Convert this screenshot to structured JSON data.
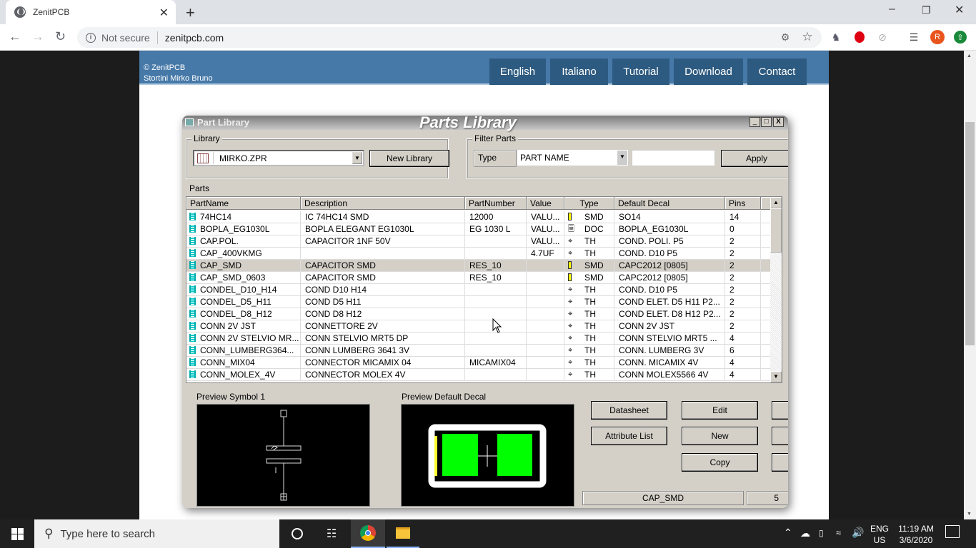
{
  "browser": {
    "tab_title": "ZenitPCB",
    "security_label": "Not secure",
    "url": "zenitpcb.com",
    "profile_initial": "R"
  },
  "site": {
    "copyright": "© ZenitPCB",
    "author": "Stortini Mirko Bruno",
    "menu": [
      "English",
      "Italiano",
      "Tutorial",
      "Download",
      "Contact"
    ]
  },
  "dialog": {
    "window_title": "Part Library",
    "banner_title": "Parts Library",
    "library_group": "Library",
    "library_value": "MIRKO.ZPR",
    "new_library": "New Library",
    "filter_group": "Filter Parts",
    "filter_type_label": "Type",
    "filter_type_value": "PART NAME",
    "filter_text": "",
    "apply": "Apply",
    "parts_label": "Parts",
    "columns": [
      "PartName",
      "Description",
      "PartNumber",
      "Value",
      "Type",
      "Default Decal",
      "Pins"
    ],
    "rows": [
      {
        "name": "74HC14",
        "desc": "IC 74HC14 SMD",
        "pn": "12000",
        "value": "VALU...",
        "type_icon": "smd",
        "type": "SMD",
        "decal": "SO14",
        "pins": "14"
      },
      {
        "name": "BOPLA_EG1030L",
        "desc": "BOPLA ELEGANT EG1030L",
        "pn": "EG 1030 L",
        "value": "VALU...",
        "type_icon": "doc",
        "type": "DOC",
        "decal": "BOPLA_EG1030L",
        "pins": "0"
      },
      {
        "name": "CAP.POL.",
        "desc": "CAPACITOR 1NF 50V",
        "pn": "",
        "value": "VALU...",
        "type_icon": "th",
        "type": "TH",
        "decal": "COND. POLI. P5",
        "pins": "2"
      },
      {
        "name": "CAP_400VKMG",
        "desc": "",
        "pn": "",
        "value": "4.7UF",
        "type_icon": "th",
        "type": "TH",
        "decal": "COND. D10 P5",
        "pins": "2"
      },
      {
        "name": "CAP_SMD",
        "desc": "CAPACITOR SMD",
        "pn": "RES_10",
        "value": "",
        "type_icon": "smd",
        "type": "SMD",
        "decal": "CAPC2012 [0805]",
        "pins": "2",
        "selected": true
      },
      {
        "name": "CAP_SMD_0603",
        "desc": "CAPACITOR SMD",
        "pn": "RES_10",
        "value": "",
        "type_icon": "smd",
        "type": "SMD",
        "decal": "CAPC2012 [0805]",
        "pins": "2"
      },
      {
        "name": "CONDEL_D10_H14",
        "desc": "COND D10 H14",
        "pn": "",
        "value": "",
        "type_icon": "th",
        "type": "TH",
        "decal": "COND. D10 P5",
        "pins": "2"
      },
      {
        "name": "CONDEL_D5_H11",
        "desc": "COND D5 H11",
        "pn": "",
        "value": "",
        "type_icon": "th",
        "type": "TH",
        "decal": "COND ELET. D5 H11 P2...",
        "pins": "2"
      },
      {
        "name": "CONDEL_D8_H12",
        "desc": "COND D8 H12",
        "pn": "",
        "value": "",
        "type_icon": "th",
        "type": "TH",
        "decal": "COND ELET. D8 H12 P2...",
        "pins": "2"
      },
      {
        "name": "CONN 2V JST",
        "desc": "CONNETTORE 2V",
        "pn": "",
        "value": "",
        "type_icon": "th",
        "type": "TH",
        "decal": "CONN 2V JST",
        "pins": "2"
      },
      {
        "name": "CONN 2V STELVIO MR...",
        "desc": "CONN STELVIO MRT5 DP",
        "pn": "",
        "value": "",
        "type_icon": "th",
        "type": "TH",
        "decal": "CONN STELVIO MRT5 ...",
        "pins": "4"
      },
      {
        "name": "CONN_LUMBERG364...",
        "desc": "CONN LUMBERG 3641 3V",
        "pn": "",
        "value": "",
        "type_icon": "th",
        "type": "TH",
        "decal": "CONN. LUMBERG 3V",
        "pins": "6"
      },
      {
        "name": "CONN_MIX04",
        "desc": "CONNECTOR MICAMIX 04",
        "pn": "MICAMIX04",
        "value": "",
        "type_icon": "th",
        "type": "TH",
        "decal": "CONN. MICAMIX 4V",
        "pins": "4"
      },
      {
        "name": "CONN_MOLEX_4V",
        "desc": "CONNECTOR MOLEX 4V",
        "pn": "",
        "value": "",
        "type_icon": "th",
        "type": "TH",
        "decal": "CONN MOLEX5566 4V",
        "pins": "4"
      }
    ],
    "preview_symbol_label": "Preview Symbol 1",
    "preview_decal_label": "Preview Default Decal",
    "buttons": {
      "datasheet": "Datasheet",
      "attribute_list": "Attribute List",
      "edit": "Edit",
      "new": "New",
      "copy": "Copy"
    },
    "status_part": "CAP_SMD",
    "status_count": "5",
    "colors": {
      "pad": "#00ff00",
      "outline": "#ffffff",
      "silk": "#ffff33"
    }
  },
  "taskbar": {
    "search_placeholder": "Type here to search",
    "lang_top": "ENG",
    "lang_bottom": "US",
    "time": "11:19 AM",
    "date": "3/6/2020"
  }
}
